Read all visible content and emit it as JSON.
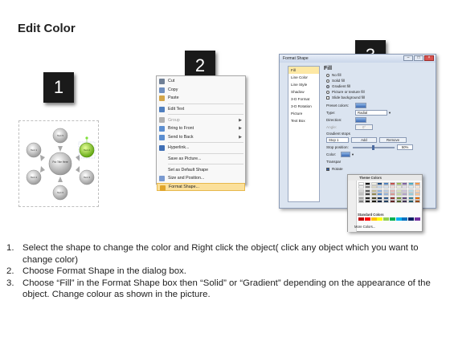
{
  "page": {
    "title": "Edit Color"
  },
  "steps": {
    "s1": "1",
    "s2": "2",
    "s3": "3"
  },
  "diagram": {
    "center_label": "Put Title Here",
    "node_labels": [
      "Text 5",
      "Text 6",
      "Text 1",
      "Text 4",
      "Text 2",
      "Text 3"
    ]
  },
  "context_menu": {
    "items": [
      {
        "label": "Cut",
        "icon": "scissors-icon",
        "color": "#6f7f95"
      },
      {
        "label": "Copy",
        "icon": "copy-icon",
        "color": "#6f8fc0"
      },
      {
        "label": "Paste",
        "icon": "paste-icon",
        "color": "#d3a64a"
      },
      {
        "label": "Edit Text",
        "icon": "edit-text-icon",
        "color": "#4f7fbf"
      },
      {
        "label": "Group",
        "icon": "group-icon",
        "color": "#b0b0b0"
      },
      {
        "label": "Bring to Front",
        "icon": "bring-front-icon",
        "color": "#5c8ed0"
      },
      {
        "label": "Send to Back",
        "icon": "send-back-icon",
        "color": "#5c8ed0"
      },
      {
        "label": "Hyperlink...",
        "icon": "hyperlink-icon",
        "color": "#3f6fb5"
      },
      {
        "label": "Save as Picture...",
        "icon": "",
        "color": ""
      },
      {
        "label": "Set as Default Shape",
        "icon": "",
        "color": ""
      },
      {
        "label": "Size and Position...",
        "icon": "size-position-icon",
        "color": "#7a9ad0"
      },
      {
        "label": "Format Shape...",
        "icon": "format-shape-icon",
        "color": "#e0a52a"
      }
    ]
  },
  "dialog": {
    "title": "Format Shape",
    "btn_min": "–",
    "btn_max": "□",
    "btn_close": "×",
    "categories": [
      "Fill",
      "Line Color",
      "Line Style",
      "Shadow",
      "3-D Format",
      "3-D Rotation",
      "Picture",
      "Text Box"
    ],
    "fill_title": "Fill",
    "options": [
      "No fill",
      "Solid fill",
      "Gradient fill",
      "Picture or texture fill",
      "Slide background fill"
    ],
    "preset_label": "Preset colors:",
    "type_label": "Type:",
    "type_value": "Radial",
    "direction_label": "Direction:",
    "angle_label": "Angle:",
    "angle_value": "0°",
    "gradient_stops_label": "Gradient stops",
    "stop_value": "Stop 1",
    "add_label": "Add",
    "remove_label": "Remove",
    "stop_position_label": "Stop position:",
    "stop_position_value": "50%",
    "color_label": "Color:",
    "transparency_label": "Transpar",
    "rotate_label": "Rotate"
  },
  "palette": {
    "theme_label": "Theme Colors",
    "standard_label": "Standard Colors",
    "more_label": "More Colors...",
    "standard_colors": [
      "#c00000",
      "#ff0000",
      "#ffc000",
      "#ffff00",
      "#92d050",
      "#00b050",
      "#00b0f0",
      "#0070c0",
      "#002060",
      "#7030a0"
    ]
  },
  "instructions": [
    {
      "num": "1.",
      "text": "Select the shape to change the color and Right click the object( click any object which you want to change color)"
    },
    {
      "num": "2.",
      "text": "Choose Format Shape in the dialog box."
    },
    {
      "num": "3.",
      "text": "Choose “Fill” in the Format Shape box then “Solid” or “Gradient” depending on the appearance of the object. Change colour as shown in the picture."
    }
  ]
}
